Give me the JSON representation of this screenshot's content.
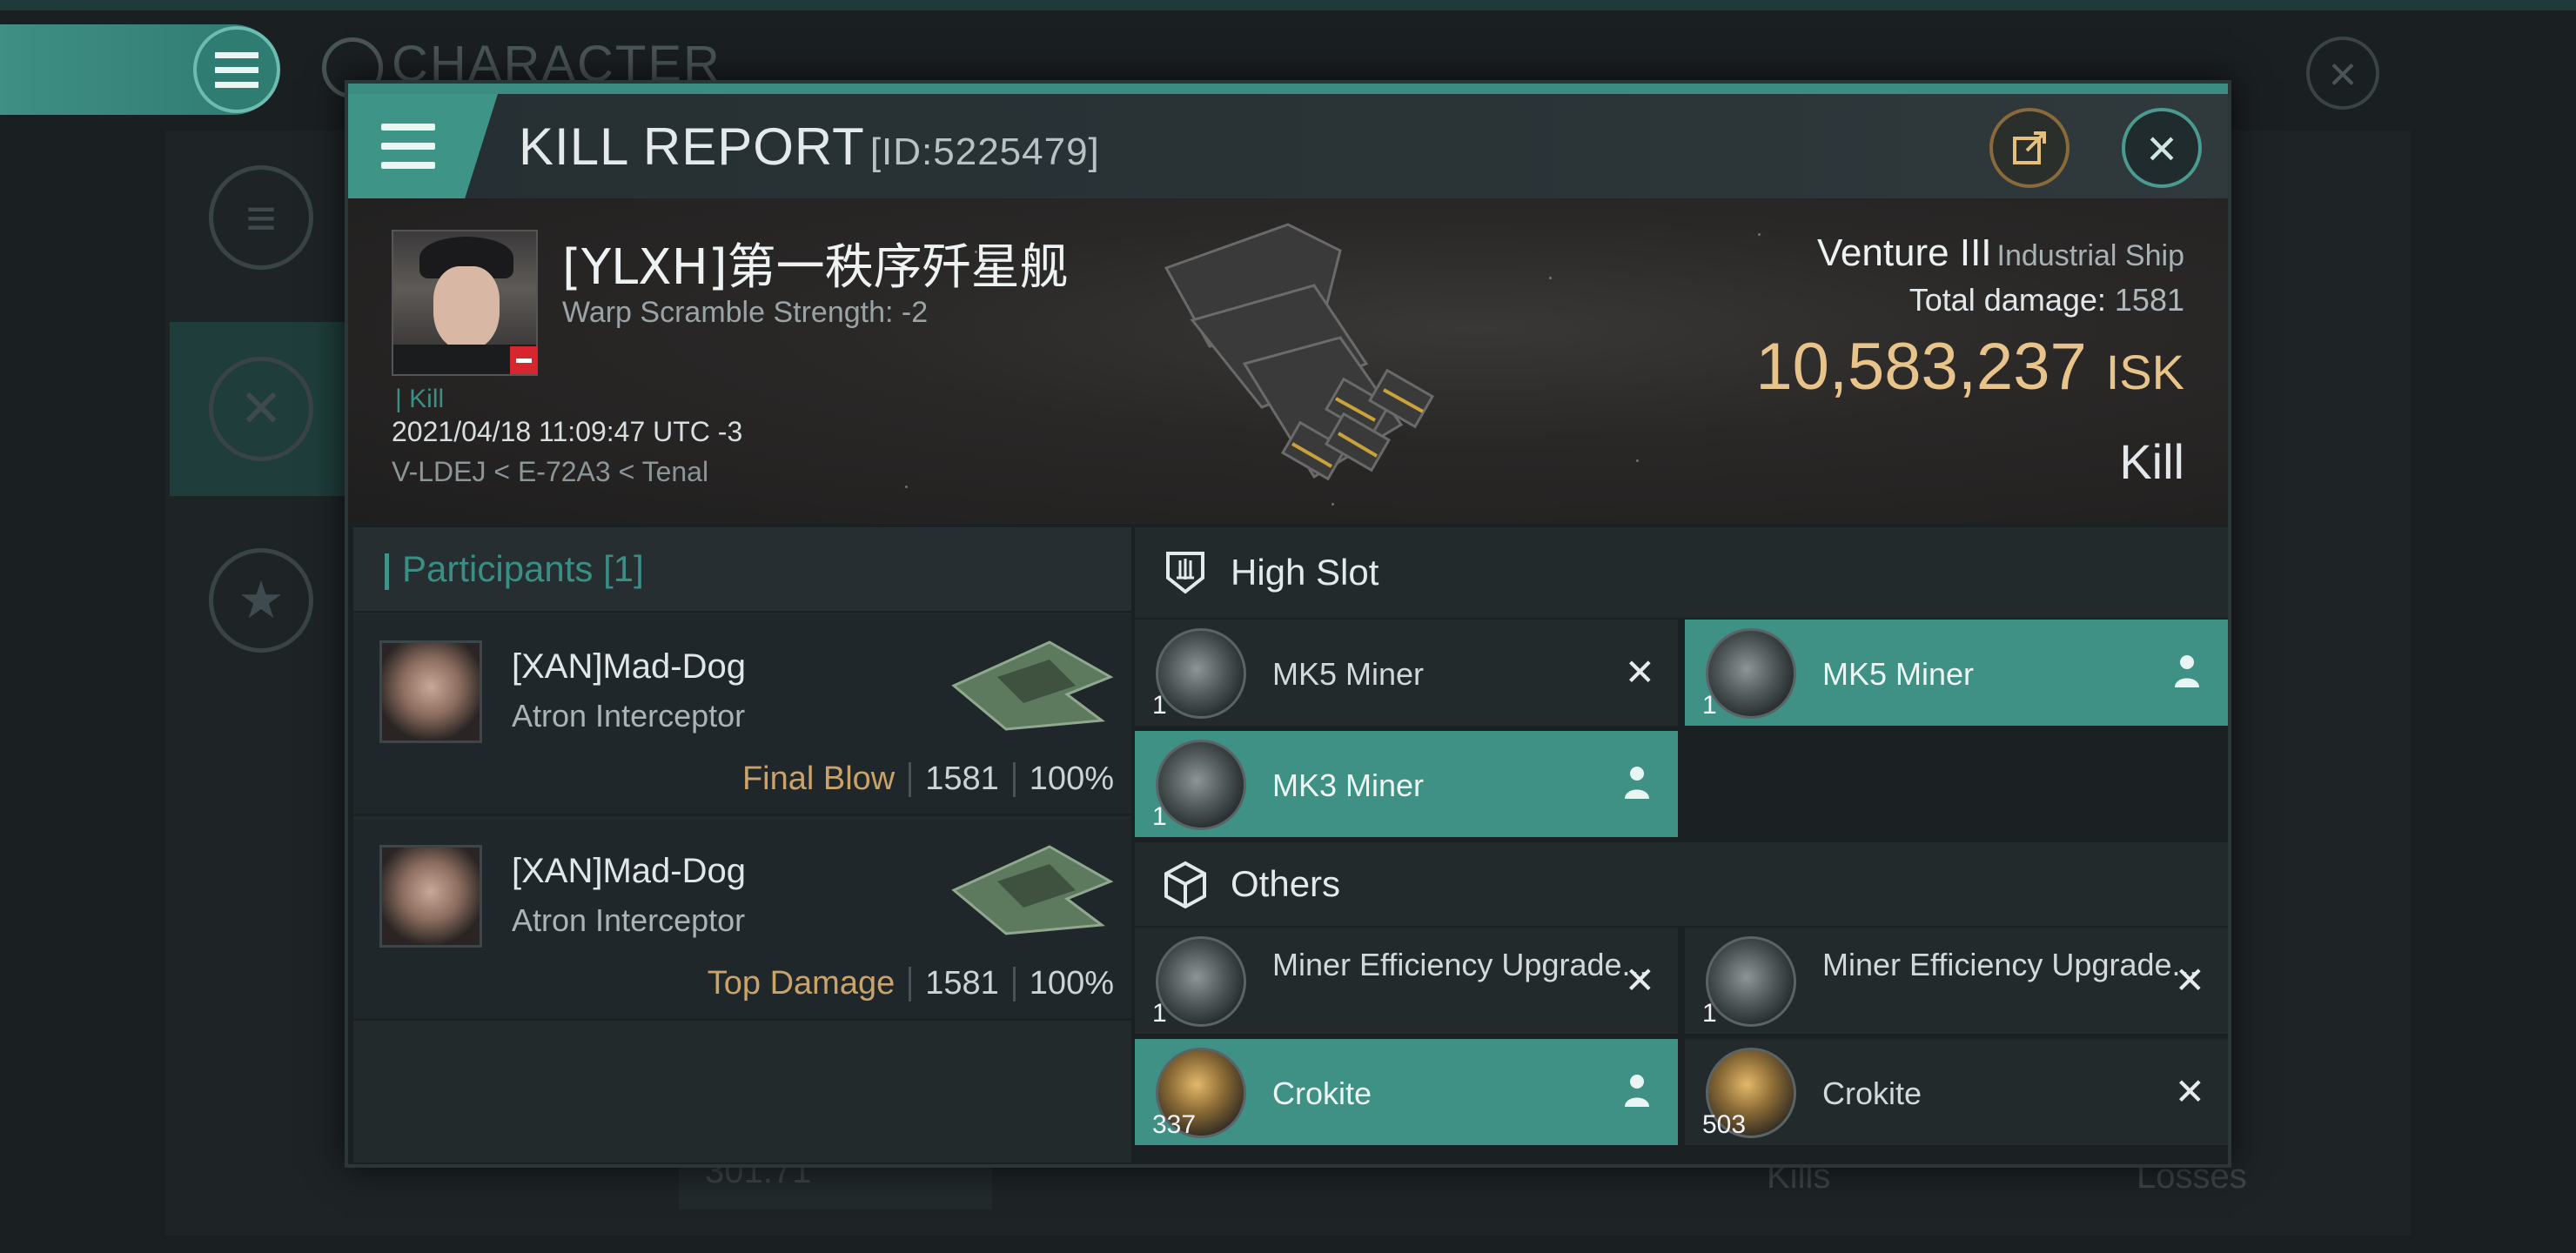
{
  "background": {
    "title": "CHARACTER",
    "footer_value": "301.71",
    "footer_kills": "Kills",
    "footer_losses": "Losses"
  },
  "report": {
    "title": "KILL REPORT",
    "id": "[ID:5225479]"
  },
  "victim": {
    "name": "[YLXH]第一秩序歼星舰",
    "warp_scramble": "Warp Scramble Strength: -2",
    "tag": "Kill",
    "datetime": "2021/04/18 11:09:47 UTC -3",
    "location": "V-LDEJ < E-72A3 < Tenal",
    "ship_name": "Venture III",
    "ship_class": "Industrial Ship",
    "total_damage_label": "Total damage:",
    "total_damage": "1581",
    "isk_value": "10,583,237",
    "isk_unit": "ISK",
    "result": "Kill"
  },
  "participants": {
    "label": "Participants",
    "count": "[1]",
    "rows": [
      {
        "name": "[XAN]Mad-Dog",
        "ship": "Atron Interceptor",
        "tag": "Final Blow",
        "damage": "1581",
        "percent": "100%"
      },
      {
        "name": "[XAN]Mad-Dog",
        "ship": "Atron Interceptor",
        "tag": "Top Damage",
        "damage": "1581",
        "percent": "100%"
      }
    ]
  },
  "fitting": {
    "high_slot_label": "High Slot",
    "others_label": "Others",
    "high": [
      {
        "name": "MK5 Miner",
        "qty": "1",
        "state": "destroyed"
      },
      {
        "name": "MK5 Miner",
        "qty": "1",
        "state": "dropped"
      },
      {
        "name": "MK3 Miner",
        "qty": "1",
        "state": "dropped"
      }
    ],
    "others": [
      {
        "name": "Miner Efficiency Upgrade...",
        "qty": "1",
        "state": "destroyed"
      },
      {
        "name": "Miner Efficiency Upgrade...",
        "qty": "1",
        "state": "destroyed"
      },
      {
        "name": "Crokite",
        "qty": "337",
        "state": "dropped"
      },
      {
        "name": "Crokite",
        "qty": "503",
        "state": "destroyed"
      }
    ]
  },
  "colors": {
    "accent": "#3f9488",
    "isk": "#e9c48a",
    "blow_tag": "#c9a36a",
    "badge": "#d7262d"
  }
}
